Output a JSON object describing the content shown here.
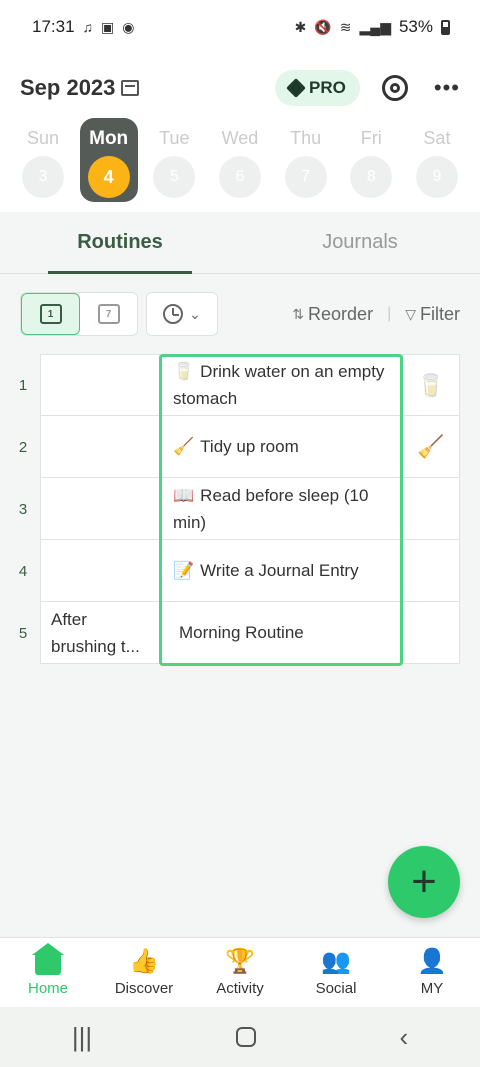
{
  "status_bar": {
    "time": "17:31",
    "battery": "53%"
  },
  "header": {
    "month": "Sep 2023",
    "pro_label": "PRO"
  },
  "week": [
    {
      "name": "Sun",
      "num": "3"
    },
    {
      "name": "Mon",
      "num": "4",
      "active": true
    },
    {
      "name": "Tue",
      "num": "5"
    },
    {
      "name": "Wed",
      "num": "6"
    },
    {
      "name": "Thu",
      "num": "7"
    },
    {
      "name": "Fri",
      "num": "8"
    },
    {
      "name": "Sat",
      "num": "9"
    }
  ],
  "tabs": {
    "routines": "Routines",
    "journals": "Journals"
  },
  "toolbar": {
    "day_view": "1",
    "week_view": "7",
    "reorder": "Reorder",
    "filter": "Filter"
  },
  "rows": [
    {
      "num": "1",
      "cue": "",
      "task_icon": "🥛",
      "task": "Drink water on an empty stomach",
      "status_icon": "🥛"
    },
    {
      "num": "2",
      "cue": "",
      "task_icon": "🧹",
      "task": "Tidy up room",
      "status_icon": "🧹"
    },
    {
      "num": "3",
      "cue": "",
      "task_icon": "📖",
      "task": "Read before sleep (10 min)",
      "status_icon": ""
    },
    {
      "num": "4",
      "cue": "",
      "task_icon": "📝",
      "task": "Write a Journal Entry",
      "status_icon": ""
    },
    {
      "num": "5",
      "cue": "After brushing t...",
      "task_icon": "",
      "task": "Morning Routine",
      "status_icon": ""
    }
  ],
  "fab": {
    "label": "+"
  },
  "bottom_nav": {
    "home": "Home",
    "discover": "Discover",
    "activity": "Activity",
    "social": "Social",
    "my": "MY"
  }
}
